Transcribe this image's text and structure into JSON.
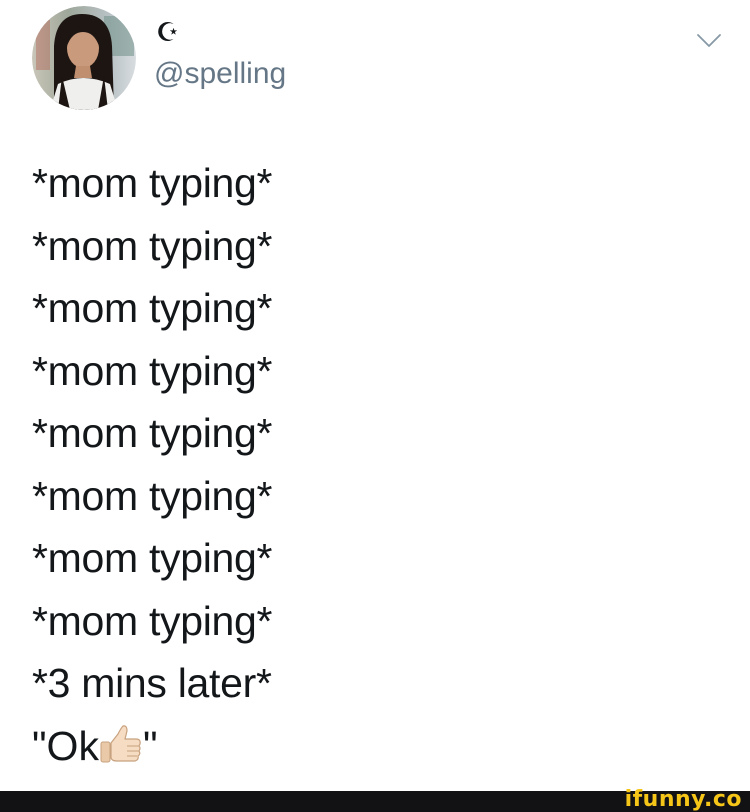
{
  "tweet": {
    "display_name": "☪︎",
    "handle": "@spelling",
    "lines": [
      "*mom typing*",
      "*mom typing*",
      "*mom typing*",
      "*mom typing*",
      "*mom typing*",
      "*mom typing*",
      "*mom typing*",
      "*mom typing*",
      "*3 mins later*"
    ],
    "final_line": {
      "prefix": "\"Ok",
      "emoji_icon": "thumbs-up-icon",
      "suffix": "\""
    }
  },
  "icons": {
    "menu": "chevron-down-icon",
    "avatar": "profile-photo"
  },
  "footer": {
    "watermark": "ifunny.co"
  },
  "colors": {
    "text": "#14171a",
    "handle": "#657786",
    "chevron": "#8899a6",
    "footer_bg": "#121214",
    "watermark": "#f5c518"
  }
}
